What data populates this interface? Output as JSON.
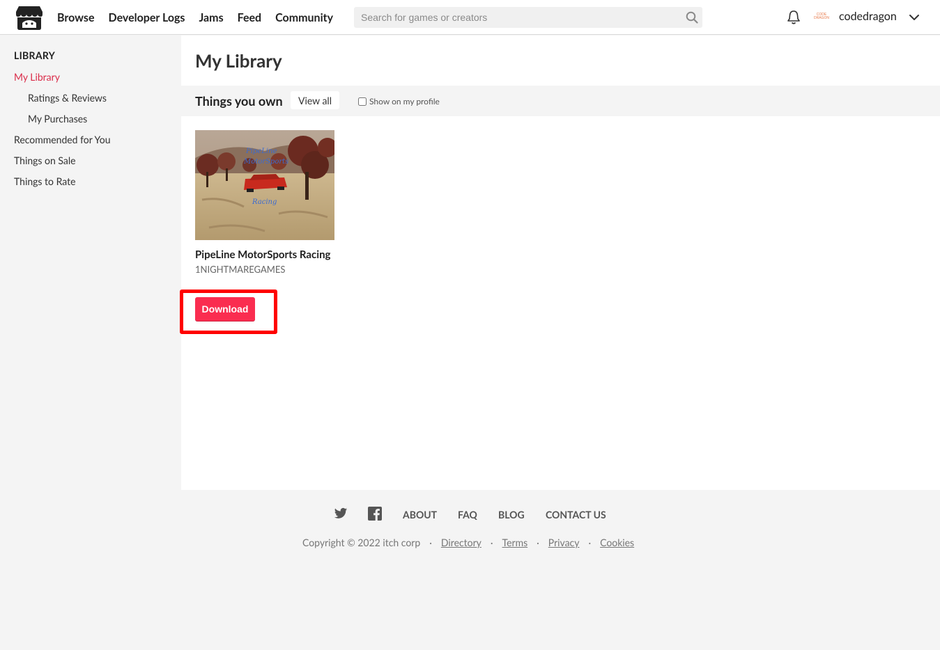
{
  "header": {
    "nav": [
      "Browse",
      "Developer Logs",
      "Jams",
      "Feed",
      "Community"
    ],
    "search_placeholder": "Search for games or creators",
    "username": "codedragon",
    "avatar_text": "CODE DRAGON"
  },
  "sidebar": {
    "title": "LIBRARY",
    "items": [
      {
        "label": "My Library",
        "active": true
      },
      {
        "label": "Ratings & Reviews"
      },
      {
        "label": "My Purchases"
      },
      {
        "label": "Recommended for You"
      },
      {
        "label": "Things on Sale"
      },
      {
        "label": "Things to Rate"
      }
    ]
  },
  "main": {
    "title": "My Library",
    "owned": {
      "title": "Things you own",
      "view_all": "View all",
      "show_profile": "Show on my profile"
    },
    "game": {
      "title": "PipeLine MotorSports Racing",
      "author": "1NIGHTMAREGAMES",
      "download_label": "Download",
      "thumb_text_1": "PipeLine",
      "thumb_text_2": "MotorSports",
      "thumb_text_3": "Racing"
    }
  },
  "footer": {
    "links": [
      "ABOUT",
      "FAQ",
      "BLOG",
      "CONTACT US"
    ],
    "copyright": "Copyright © 2022 itch corp",
    "legal": [
      "Directory",
      "Terms",
      "Privacy",
      "Cookies"
    ]
  },
  "colors": {
    "accent": "#fa2d50",
    "active_nav": "#da2c49",
    "highlight": "#ff0000"
  }
}
